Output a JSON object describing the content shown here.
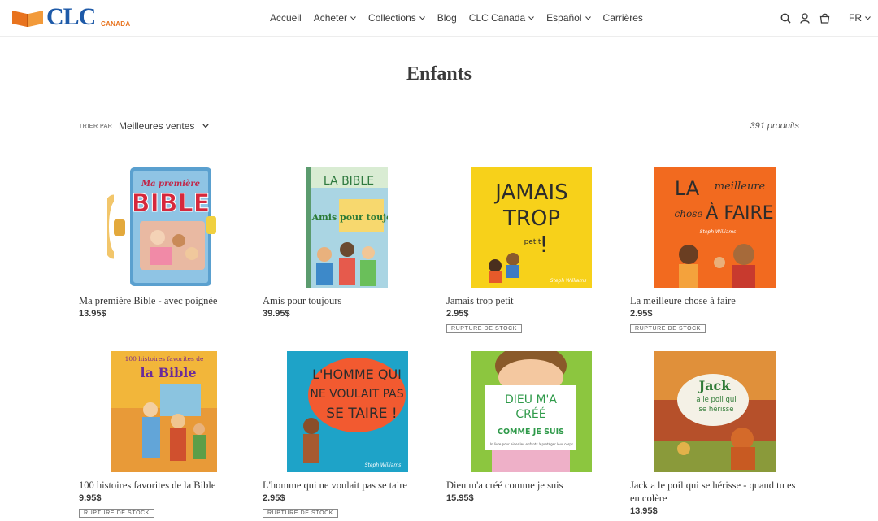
{
  "brand": {
    "name": "CLC",
    "sub": "CANADA"
  },
  "nav": [
    {
      "label": "Accueil",
      "has_dropdown": false
    },
    {
      "label": "Acheter",
      "has_dropdown": true
    },
    {
      "label": "Collections",
      "has_dropdown": true,
      "active": true
    },
    {
      "label": "Blog",
      "has_dropdown": false
    },
    {
      "label": "CLC Canada",
      "has_dropdown": true
    },
    {
      "label": "Español",
      "has_dropdown": true
    },
    {
      "label": "Carrières",
      "has_dropdown": false
    }
  ],
  "header_icons": [
    "search-icon",
    "account-icon",
    "cart-icon"
  ],
  "language": "FR",
  "page_title": "Enfants",
  "sort": {
    "label": "TRIER PAR",
    "value": "Meilleures ventes"
  },
  "product_count": "391 produits",
  "products": [
    {
      "title": "Ma première Bible - avec poignée",
      "price": "13.95$",
      "badge": ""
    },
    {
      "title": "Amis pour toujours",
      "price": "39.95$",
      "badge": ""
    },
    {
      "title": "Jamais trop petit",
      "price": "2.95$",
      "badge": "RUPTURE DE STOCK"
    },
    {
      "title": "La meilleure chose à faire",
      "price": "2.95$",
      "badge": "RUPTURE DE STOCK"
    },
    {
      "title": "100 histoires favorites de la Bible",
      "price": "9.95$",
      "badge": "RUPTURE DE STOCK"
    },
    {
      "title": "L'homme qui ne voulait pas se taire",
      "price": "2.95$",
      "badge": "RUPTURE DE STOCK"
    },
    {
      "title": "Dieu m'a créé comme je suis",
      "price": "15.95$",
      "badge": ""
    },
    {
      "title": "Jack a le poil qui se hérisse - quand tu es en colère",
      "price": "13.95$",
      "badge": ""
    }
  ],
  "covers": {
    "c1": {
      "top": "Ma première",
      "main": "BIBLE"
    },
    "c2": {
      "top": "LA BIBLE",
      "mid": "Amis pour toujours"
    },
    "c3": {
      "l1": "JAMAIS",
      "l2": "TROP",
      "l3": "petit",
      "l4": "!",
      "author": "Steph Williams"
    },
    "c4": {
      "l1": "LA",
      "l2": "meilleure",
      "l3": "chose",
      "l4": "À FAIRE",
      "author": "Steph Williams"
    },
    "c5": {
      "l1": "100 histoires favorites de",
      "l2": "la Bible"
    },
    "c6": {
      "l1": "L'HOMME QUI",
      "l2": "NE VOULAIT PAS",
      "l3": "SE TAIRE !",
      "author": "Steph Williams"
    },
    "c7": {
      "l1": "DIEU M'A",
      "l2": "CRÉÉ",
      "l3": "COMME JE SUIS",
      "l4": "Un livre pour aider les enfants à protéger leur corps"
    },
    "c8": {
      "l1": "Jack",
      "l2": "a le poil qui",
      "l3": "se hérisse"
    }
  },
  "colors": {
    "text": "#3a3a3a",
    "brand_blue": "#1e5aa8",
    "brand_orange": "#e8731e"
  }
}
